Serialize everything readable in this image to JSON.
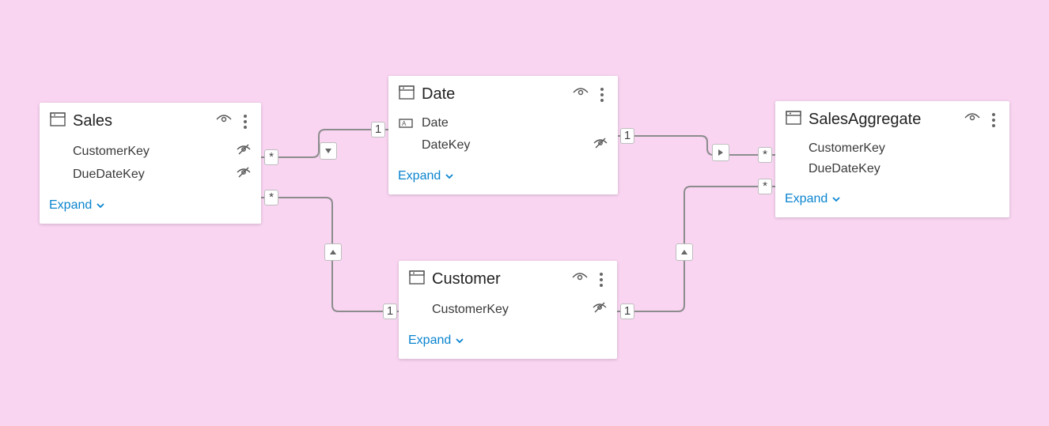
{
  "tables": {
    "sales": {
      "title": "Sales",
      "fields": [
        {
          "name": "CustomerKey",
          "hidden": true
        },
        {
          "name": "DueDateKey",
          "hidden": true
        }
      ],
      "expand": "Expand"
    },
    "date": {
      "title": "Date",
      "fields": [
        {
          "name": "Date",
          "hasIcon": true
        },
        {
          "name": "DateKey",
          "hidden": true
        }
      ],
      "expand": "Expand"
    },
    "customer": {
      "title": "Customer",
      "fields": [
        {
          "name": "CustomerKey",
          "hidden": true
        }
      ],
      "expand": "Expand"
    },
    "salesAggregate": {
      "title": "SalesAggregate",
      "fields": [
        {
          "name": "CustomerKey"
        },
        {
          "name": "DueDateKey"
        }
      ],
      "expand": "Expand"
    }
  },
  "relationships": [
    {
      "from": "sales",
      "to": "date",
      "from_card": "*",
      "to_card": "1",
      "direction": "to-from"
    },
    {
      "from": "sales",
      "to": "customer",
      "from_card": "*",
      "to_card": "1",
      "direction": "to-from"
    },
    {
      "from": "salesAggregate",
      "to": "date",
      "from_card": "*",
      "to_card": "1",
      "direction": "from-to"
    },
    {
      "from": "salesAggregate",
      "to": "customer",
      "from_card": "*",
      "to_card": "1",
      "direction": "to-from"
    }
  ]
}
